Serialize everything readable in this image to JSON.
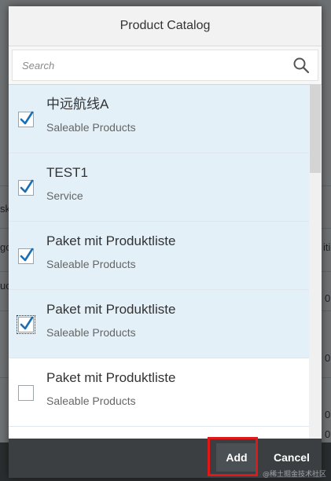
{
  "dialog": {
    "title": "Product Catalog",
    "search_placeholder": "Search",
    "search_icon": "search-icon"
  },
  "items": [
    {
      "title": "中远航线A",
      "subtitle": "Saleable Products",
      "checked": true,
      "focused": false
    },
    {
      "title": "TEST1",
      "subtitle": "Service",
      "checked": true,
      "focused": false
    },
    {
      "title": "Paket mit Produktliste",
      "subtitle": "Saleable Products",
      "checked": true,
      "focused": false
    },
    {
      "title": "Paket mit Produktliste",
      "subtitle": "Saleable Products",
      "checked": true,
      "focused": true
    },
    {
      "title": "Paket mit Produktliste",
      "subtitle": "Saleable Products",
      "checked": false,
      "focused": false
    }
  ],
  "footer": {
    "add_label": "Add",
    "cancel_label": "Cancel"
  },
  "background_fragments": [
    "sk",
    "go",
    "uc",
    "iti",
    "0",
    "0",
    "0",
    "0"
  ],
  "watermark": "@稀土掘金技术社区",
  "colors": {
    "selected_row": "#e3f0f8",
    "check_mark": "#1a6fb4",
    "footer": "#3b3f42",
    "highlight": "#e01818"
  }
}
